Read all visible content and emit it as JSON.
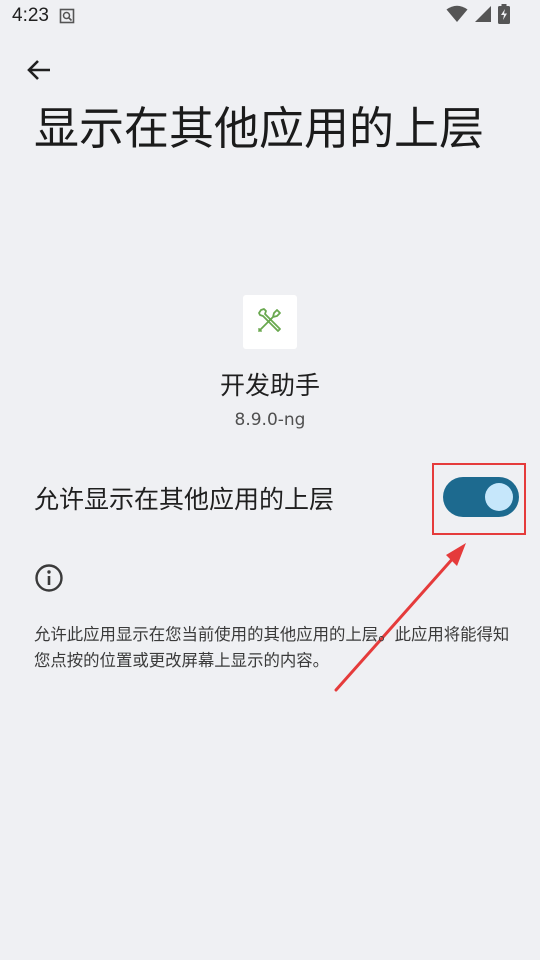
{
  "status_bar": {
    "time": "4:23",
    "icons": [
      "search-notification-icon",
      "wifi-icon",
      "signal-icon",
      "battery-charging-icon"
    ]
  },
  "header": {
    "back_icon": "arrow-back-icon",
    "title": "显示在其他应用的上层"
  },
  "app": {
    "icon": "tools-icon",
    "name": "开发助手",
    "version": "8.9.0-ng"
  },
  "permission": {
    "label": "允许显示在其他应用的上层",
    "enabled": true
  },
  "info": {
    "icon": "info-icon",
    "description": "允许此应用显示在您当前使用的其他应用的上层。此应用将能得知您点按的位置或更改屏幕上显示的内容。"
  },
  "colors": {
    "background": "#eff0f3",
    "toggle_track_on": "#1d6a8f",
    "toggle_thumb_on": "#c6e7fb",
    "annotation_red": "#e53b3b",
    "app_icon_green": "#6aa84f"
  }
}
